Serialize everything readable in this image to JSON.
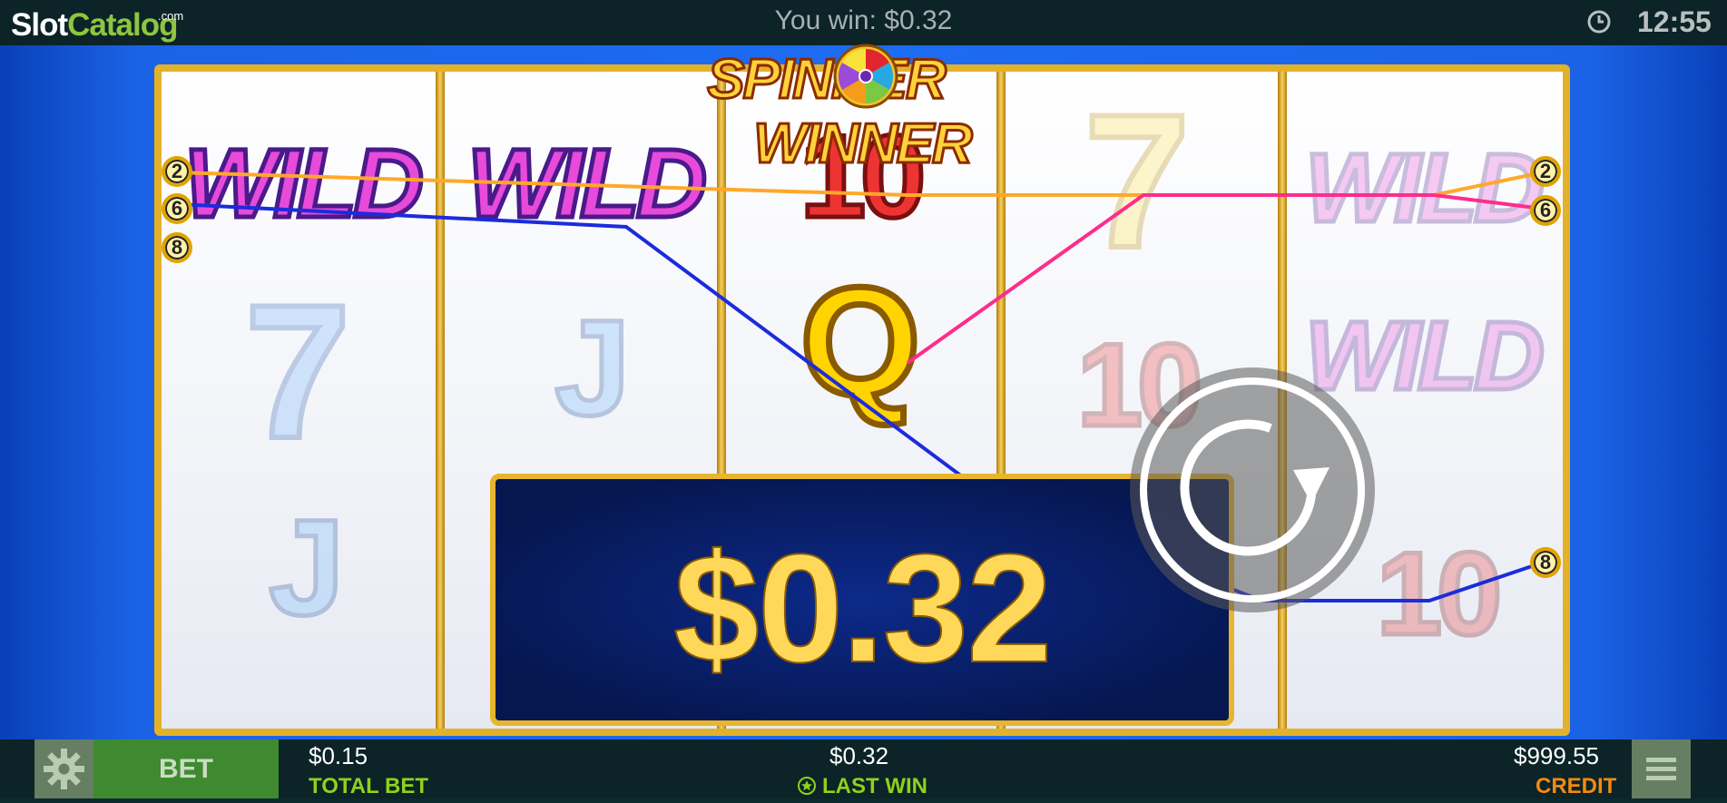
{
  "topbar": {
    "logo_slot": "Slot",
    "logo_catalog": "Catalog",
    "logo_com": ".com",
    "you_win": "You win: $0.32",
    "time": "12:55"
  },
  "game": {
    "title_left": "SPINNER",
    "title_right": "WINNER",
    "win_amount": "$0.32",
    "reels": [
      [
        "WILD",
        "7",
        "J"
      ],
      [
        "WILD",
        "J"
      ],
      [
        "10",
        "Q"
      ],
      [
        "7",
        "10"
      ],
      [
        "WILD",
        "WILD",
        "10"
      ]
    ],
    "left_badges": [
      "2",
      "6",
      "8"
    ],
    "right_badges": [
      "2",
      "6",
      "8"
    ],
    "line_colors": {
      "line2": "#ffa82a",
      "line6": "#ff2c8c",
      "line8": "#1b2cdc"
    }
  },
  "bottombar": {
    "bet_label": "BET",
    "total_bet_value": "$0.15",
    "total_bet_label": "TOTAL BET",
    "last_win_value": "$0.32",
    "last_win_label": "LAST WIN",
    "credit_value": "$999.55",
    "credit_label": "CREDIT",
    "colors": {
      "total_bet": "#8ed21c",
      "last_win": "#8ed21c",
      "credit": "#f08a12"
    }
  }
}
